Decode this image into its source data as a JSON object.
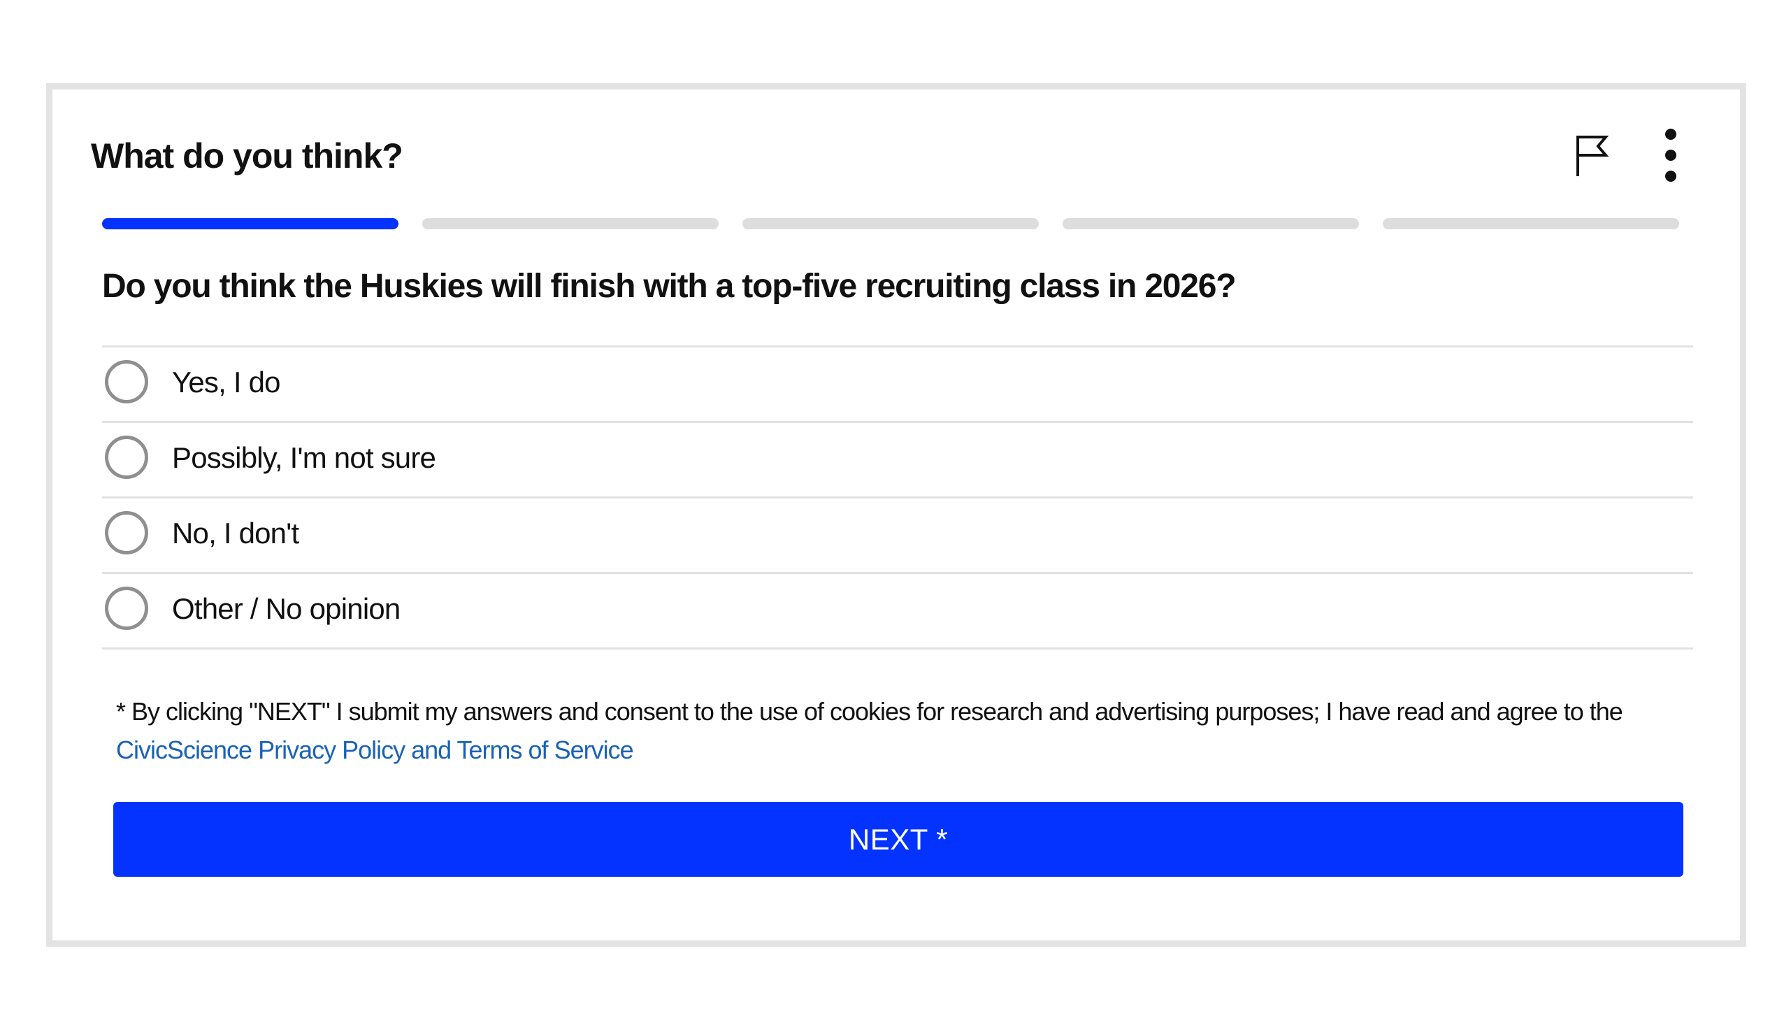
{
  "header": {
    "title": "What do you think?",
    "flag_icon": "flag-icon",
    "more_icon": "more-vertical-icon"
  },
  "progress": {
    "total_steps": 5,
    "current_step": 1
  },
  "question": {
    "text": "Do you think the Huskies will finish with a top-five recruiting class in 2026?",
    "options": [
      {
        "label": "Yes, I do"
      },
      {
        "label": "Possibly, I'm not sure"
      },
      {
        "label": "No, I don't"
      },
      {
        "label": "Other / No opinion"
      }
    ]
  },
  "consent": {
    "text": "* By clicking \"NEXT\" I submit my answers and consent to the use of cookies for research and advertising purposes; I have read and agree to the",
    "link_label": "CivicScience Privacy Policy and Terms of Service"
  },
  "next_button": {
    "label": "NEXT *"
  },
  "colors": {
    "accent": "#0433ff",
    "link": "#1a62b5",
    "progress_inactive": "#dddddd",
    "border": "#e3e3e3"
  }
}
